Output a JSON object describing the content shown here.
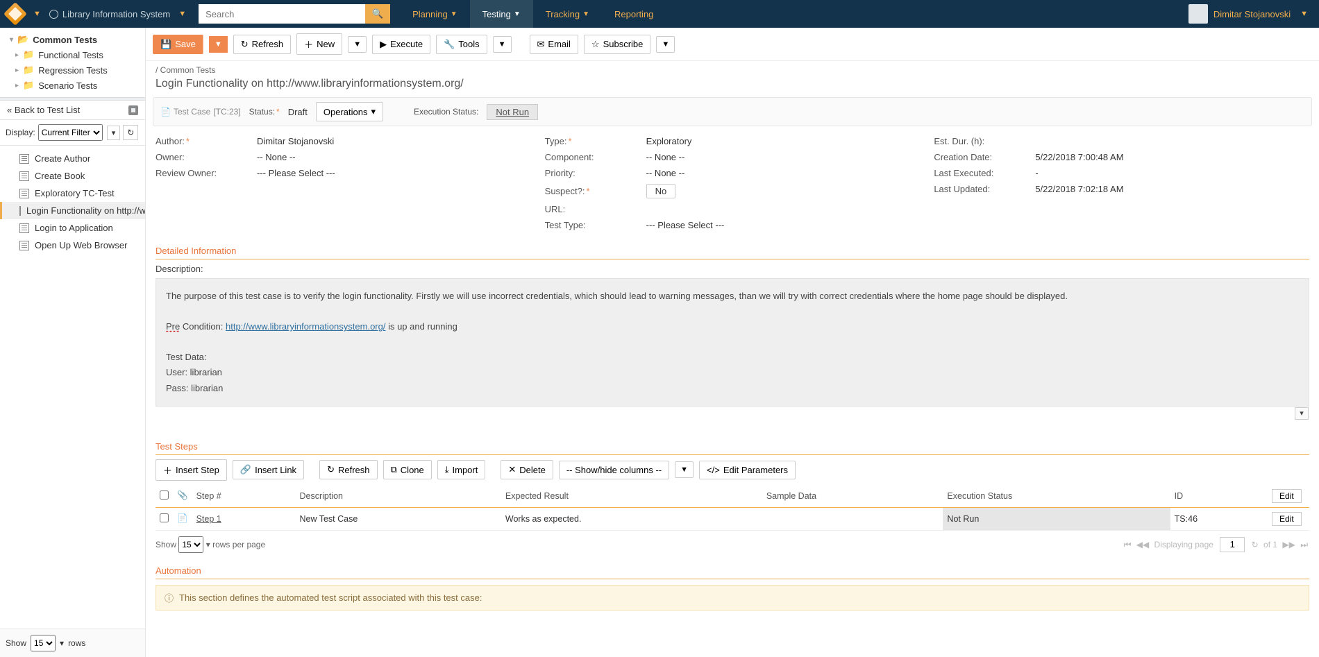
{
  "topbar": {
    "product": "Library Information System",
    "search_placeholder": "Search",
    "nav": [
      {
        "label": "Planning",
        "active": false,
        "caret": true
      },
      {
        "label": "Testing",
        "active": true,
        "caret": true
      },
      {
        "label": "Tracking",
        "active": false,
        "caret": true
      },
      {
        "label": "Reporting",
        "active": false,
        "caret": false
      }
    ],
    "user": "Dimitar Stojanovski"
  },
  "tree": {
    "root": "Common Tests",
    "children": [
      "Functional Tests",
      "Regression Tests",
      "Scenario Tests"
    ]
  },
  "sidebar": {
    "back": "Back to Test List",
    "display_label": "Display:",
    "display_value": "Current Filter",
    "tc_items": [
      "Create Author",
      "Create Book",
      "Exploratory TC-Test",
      "Login Functionality on http://w",
      "Login to Application",
      "Open Up Web Browser"
    ],
    "tc_active_index": 3,
    "footer_show": "Show",
    "footer_rows": "rows",
    "footer_value": "15"
  },
  "toolbar": {
    "save": "Save",
    "refresh": "Refresh",
    "new": "New",
    "execute": "Execute",
    "tools": "Tools",
    "email_": "Email",
    "subscribe": "Subscribe"
  },
  "breadcrumb": "/ Common Tests",
  "page_title": "Login Functionality on http://www.libraryinformationsystem.org/",
  "statusbar": {
    "chip_prefix": "Test Case",
    "chip_id": "[TC:23]",
    "status_label": "Status:",
    "status_value": "Draft",
    "operations": "Operations",
    "exec_status_label": "Execution Status:",
    "exec_status_value": "Not Run"
  },
  "props": {
    "left": [
      {
        "k": "Author:",
        "v": "Dimitar Stojanovski",
        "req": true
      },
      {
        "k": "Owner:",
        "v": "-- None --"
      },
      {
        "k": "Review Owner:",
        "v": "--- Please Select ---"
      }
    ],
    "mid": [
      {
        "k": "Type:",
        "v": "Exploratory",
        "req": true
      },
      {
        "k": "Component:",
        "v": "-- None --"
      },
      {
        "k": "Priority:",
        "v": "-- None --"
      },
      {
        "k": "Suspect?:",
        "v": "No",
        "req": true,
        "badge": true
      },
      {
        "k": "URL:",
        "v": ""
      },
      {
        "k": "Test Type:",
        "v": "--- Please Select ---"
      }
    ],
    "right": [
      {
        "k": "Est. Dur. (h):",
        "v": ""
      },
      {
        "k": "Creation Date:",
        "v": "5/22/2018 7:00:48 AM"
      },
      {
        "k": "Last Executed:",
        "v": "-"
      },
      {
        "k": "Last Updated:",
        "v": "5/22/2018 7:02:18 AM"
      }
    ]
  },
  "sections": {
    "detailed": "Detailed Information",
    "test_steps": "Test Steps",
    "automation": "Automation"
  },
  "description": {
    "label": "Description:",
    "para1": "The purpose of this test case is to verify the login functionality. Firstly we will use incorrect credentials, which should lead to warning messages, than we will try with correct credentials where the home page should be displayed.",
    "pre_word": "Pre",
    "pre_rest": " Condition: ",
    "link": "http://www.libraryinformationsystem.org/",
    "pre_tail": " is up and running",
    "test_data": "Test Data:",
    "user": "User: librarian",
    "pass": "Pass: librarian"
  },
  "step_toolbar": {
    "insert_step": "Insert Step",
    "insert_link": "Insert Link",
    "refresh": "Refresh",
    "clone": "Clone",
    "import_": "Import",
    "delete_": "Delete",
    "showhide": "-- Show/hide columns --",
    "editparams": "Edit Parameters"
  },
  "steps_table": {
    "headers": [
      "",
      "",
      "Step #",
      "Description",
      "Expected Result",
      "Sample Data",
      "Execution Status",
      "ID",
      ""
    ],
    "edit_header": "Edit",
    "rows": [
      {
        "step": "Step 1",
        "desc": "New Test Case",
        "expected": "Works as expected.",
        "sample": "",
        "exec": "Not Run",
        "id": "TS:46",
        "edit": "Edit"
      }
    ]
  },
  "pager": {
    "show": "Show",
    "value": "15",
    "rows_per_page": "rows per page",
    "displaying": "Displaying page",
    "current": "1",
    "of": "of 1"
  },
  "automation_text": "This section defines the automated test script associated with this test case:"
}
